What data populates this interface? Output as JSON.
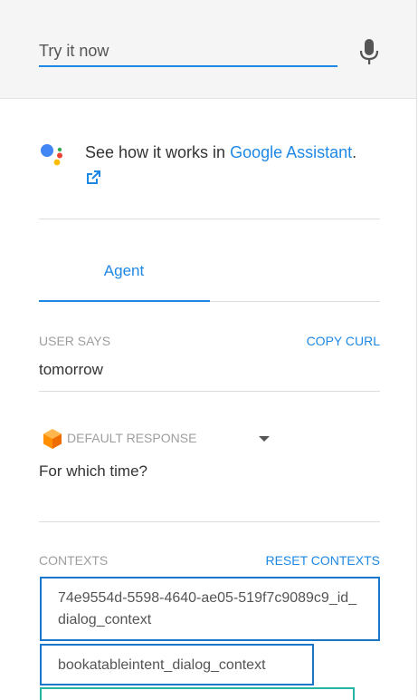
{
  "try_it": {
    "placeholder": "Try it now"
  },
  "assistant": {
    "prefix": "See how it works in ",
    "link": "Google Assistant",
    "suffix": "."
  },
  "tabs": [
    {
      "label": "Agent"
    }
  ],
  "user_says": {
    "label": "USER SAYS",
    "action": "COPY CURL",
    "value": "tomorrow"
  },
  "response": {
    "label": "DEFAULT RESPONSE",
    "value": "For which time?"
  },
  "contexts": {
    "label": "CONTEXTS",
    "action": "RESET CONTEXTS",
    "items": [
      {
        "name": "74e9554d-5598-4640-ae05-519f7c9089c9_id_dialog_context"
      },
      {
        "name": "bookatableintent_dialog_context"
      }
    ]
  },
  "colors": {
    "accent": "#1e88e5",
    "context_border": "#1976c8",
    "context_teal": "#26b5a2"
  }
}
